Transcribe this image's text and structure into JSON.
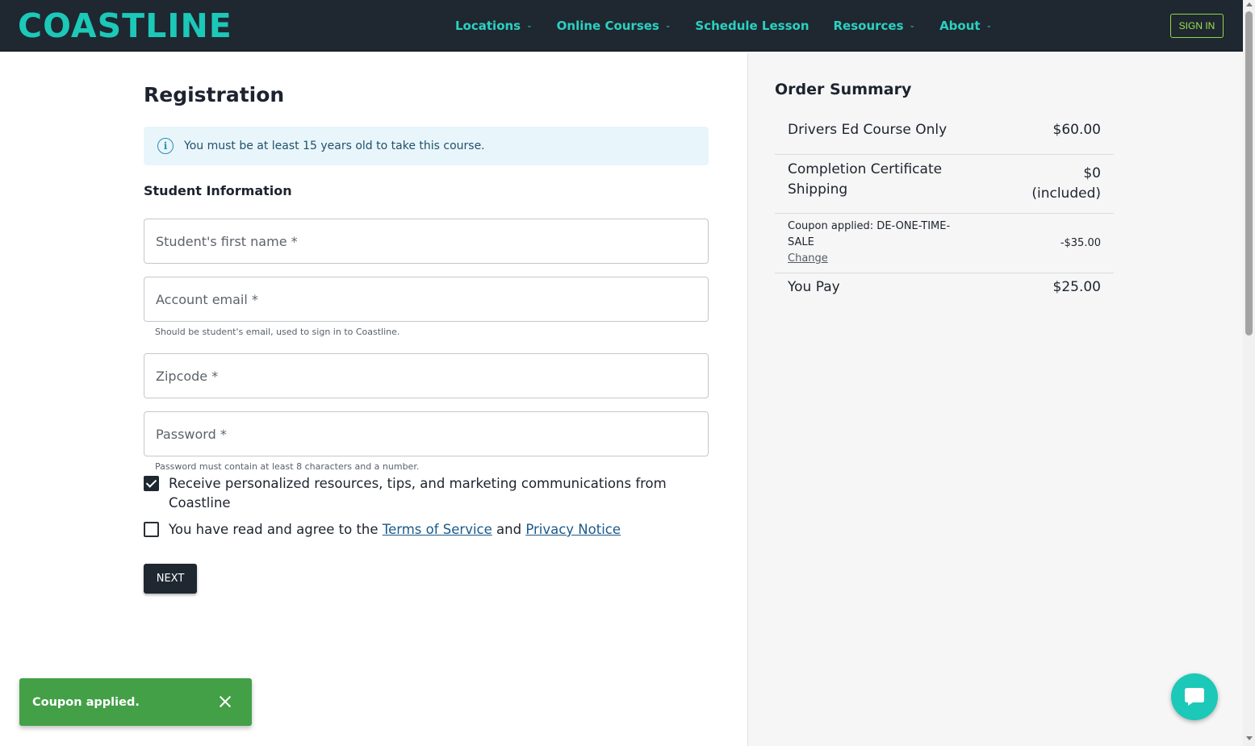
{
  "header": {
    "logo": "COASTLINE",
    "nav": [
      {
        "label": "Locations",
        "has_dropdown": true
      },
      {
        "label": "Online Courses",
        "has_dropdown": true
      },
      {
        "label": "Schedule Lesson",
        "has_dropdown": false
      },
      {
        "label": "Resources",
        "has_dropdown": true
      },
      {
        "label": "About",
        "has_dropdown": true
      }
    ],
    "sign_in": "SIGN IN"
  },
  "registration": {
    "title": "Registration",
    "alert": "You must be at least 15 years old to take this course.",
    "section_title": "Student Information",
    "fields": {
      "first_name": {
        "placeholder": "Student's first name *",
        "value": ""
      },
      "email": {
        "placeholder": "Account email *",
        "value": "",
        "hint": "Should be student's email, used to sign in to Coastline."
      },
      "zipcode": {
        "placeholder": "Zipcode *",
        "value": ""
      },
      "password": {
        "placeholder": "Password *",
        "value": "",
        "hint": "Password must contain at least 8 characters and a number."
      }
    },
    "marketing_consent": {
      "checked": true,
      "label": "Receive personalized resources, tips, and marketing communications from Coastline"
    },
    "terms": {
      "checked": false,
      "prefix": "You have read and agree to the",
      "terms_link": "Terms of Service",
      "conjunction": "and",
      "privacy_link": "Privacy Notice"
    },
    "next_button": "NEXT"
  },
  "order_summary": {
    "title": "Order Summary",
    "course": {
      "label": "Drivers Ed Course Only",
      "price": "$60.00"
    },
    "shipping": {
      "label_line1": "Completion Certificate",
      "label_line2": "Shipping",
      "price_line1": "$0",
      "price_line2": "(included)"
    },
    "coupon": {
      "label_line1": "Coupon applied: DE-ONE-TIME-",
      "label_line2": "SALE",
      "change_link": "Change",
      "amount": "-$35.00"
    },
    "total": {
      "label": "You Pay",
      "amount": "$25.00"
    }
  },
  "toast": {
    "message": "Coupon applied."
  },
  "colors": {
    "brand_teal": "#1cc8b8",
    "header_bg": "#1f2731",
    "toast_green": "#43a047",
    "signin_green": "#9be14f"
  }
}
